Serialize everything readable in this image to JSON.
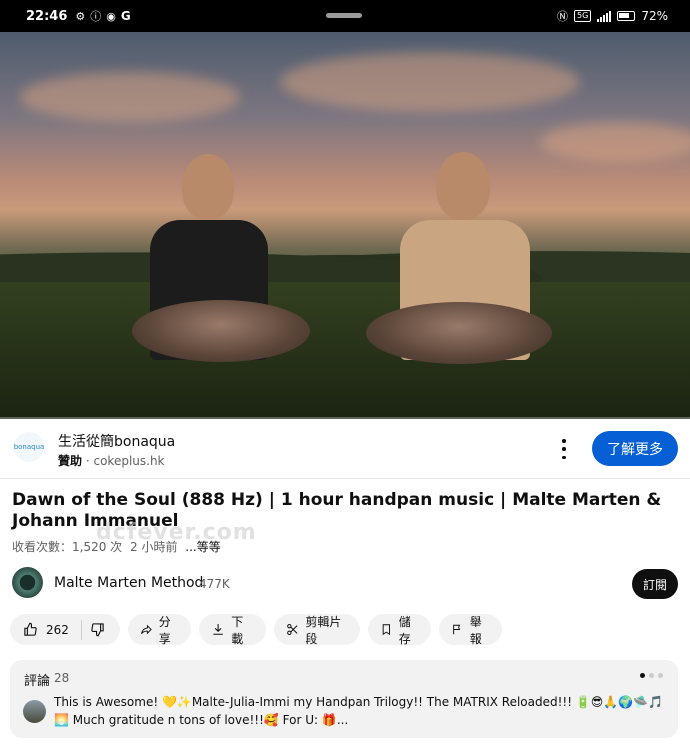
{
  "status_bar": {
    "time": "22:46",
    "left_icons": [
      "gear-icon",
      "info-icon",
      "app-icon",
      "google-g-icon"
    ],
    "g_label": "G",
    "network": "5G",
    "battery": "72%"
  },
  "ad": {
    "logo_text": "bonaqua",
    "title": "生活從簡bonaqua",
    "sponsored": "贊助",
    "domain": "cokeplus.hk",
    "cta": "了解更多",
    "cta_color": "#065fd4"
  },
  "video": {
    "title": "Dawn of the Soul (888 Hz) | 1 hour handpan music | Malte Marten & Johann Immanuel",
    "views": "收看次數：1,520 次",
    "age": "2 小時前",
    "more": "...等等"
  },
  "watermark": "dcfever.com",
  "channel": {
    "name": "Malte Marten Method",
    "subscribers": "477K",
    "subscribe_label": "訂閱"
  },
  "actions": {
    "like_count": "262",
    "share": "分享",
    "download": "下載",
    "clip": "剪輯片段",
    "save": "儲存",
    "report": "舉報"
  },
  "comments": {
    "label": "評論",
    "count": "28",
    "top_comment": "This is Awesome! 💛✨Malte-Julia-Immi my Handpan Trilogy!! The MATRIX Reloaded!!! 🔋😎🙏🌍🛸🎵🌅 Much gratitude n tons of love!!!🥰 For U: 🎁..."
  }
}
